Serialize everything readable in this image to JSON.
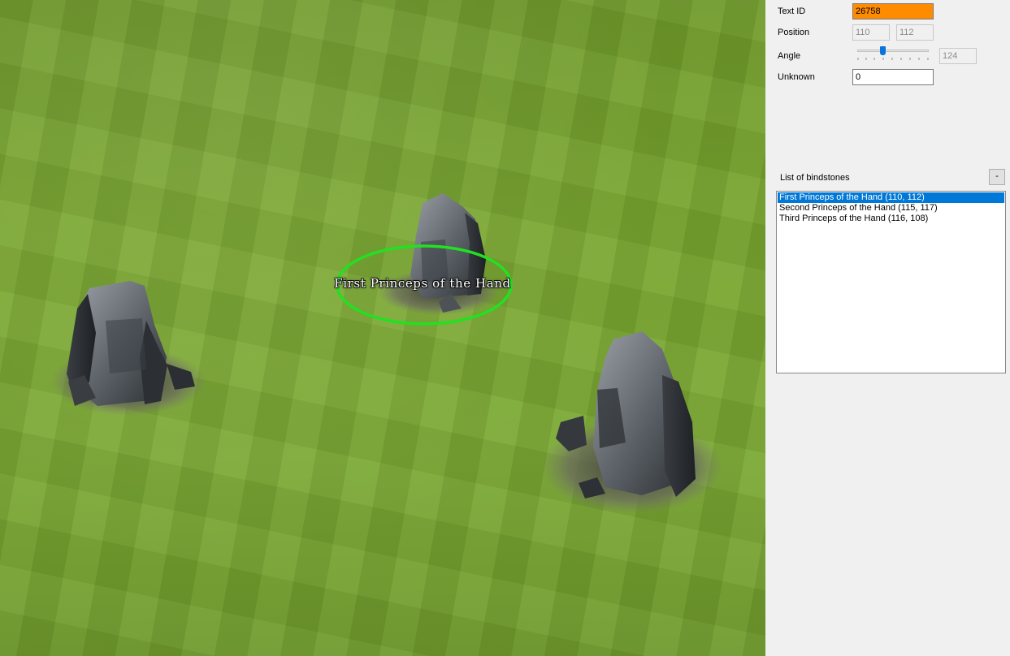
{
  "viewport": {
    "selected_label": "First Princeps of the Hand"
  },
  "panel": {
    "text_id": {
      "label": "Text ID",
      "value": "26758"
    },
    "position": {
      "label": "Position",
      "x": "110",
      "y": "112"
    },
    "angle": {
      "label": "Angle",
      "value": "124",
      "slider_fraction": 0.35
    },
    "unknown": {
      "label": "Unknown",
      "value": "0"
    },
    "list": {
      "label": "List of bindstones",
      "remove_button": "-",
      "items": [
        "First Princeps of the Hand (110, 112)",
        "Second Princeps of the Hand (115, 117)",
        "Third Princeps of the Hand (116, 108)"
      ],
      "selected_index": 0
    }
  },
  "colors": {
    "highlight": "#ff8c00",
    "selection": "#0078d7",
    "selection_ring": "#22e022"
  }
}
